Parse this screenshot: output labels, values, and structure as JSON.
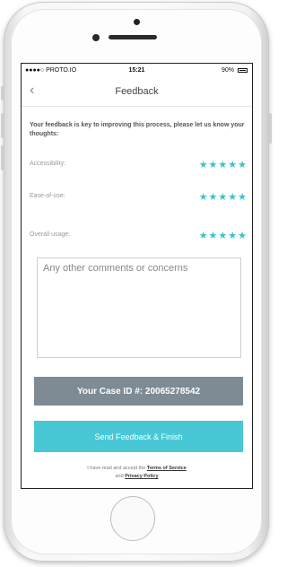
{
  "status_bar": {
    "carrier": "●●●●○ PROTO.IO",
    "time": "15:21",
    "battery": "90%"
  },
  "nav": {
    "back_icon": "chevron-left-icon",
    "title": "Feedback"
  },
  "intro_text": "Your feedback is key to improving this process, please let us know your thoughts:",
  "ratings": [
    {
      "label": "Accessibility:",
      "stars": "★★★★★",
      "value": 5,
      "max": 5
    },
    {
      "label": "Ease-of-use:",
      "stars": "★★★★★",
      "value": 5,
      "max": 5
    },
    {
      "label": "Overall usage:",
      "stars": "★★★★★",
      "value": 5,
      "max": 5
    }
  ],
  "comments": {
    "placeholder": "Any other comments or concerns",
    "value": ""
  },
  "case_id_label": "Your Case ID #: 20065278542",
  "send_button": "Send Feedback & Finish",
  "legal": {
    "prefix": "I have read and accept the",
    "terms": "Terms of Service",
    "and": "and",
    "privacy": "Privacy Policy"
  },
  "colors": {
    "accent": "#48c8d5",
    "star": "#39c3c8",
    "case_id_bg": "#7e8b95"
  }
}
